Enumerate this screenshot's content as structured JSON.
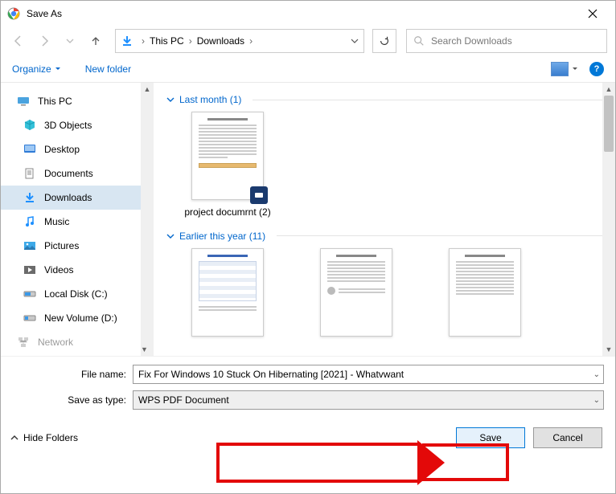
{
  "window": {
    "title": "Save As"
  },
  "nav": {
    "crumb1": "This PC",
    "crumb2": "Downloads",
    "search_placeholder": "Search Downloads"
  },
  "toolbar": {
    "organize": "Organize",
    "new_folder": "New folder"
  },
  "tree": {
    "this_pc": "This PC",
    "objects3d": "3D Objects",
    "desktop": "Desktop",
    "documents": "Documents",
    "downloads": "Downloads",
    "music": "Music",
    "pictures": "Pictures",
    "videos": "Videos",
    "local_c": "Local Disk (C:)",
    "new_vol_d": "New Volume (D:)",
    "network": "Network"
  },
  "groups": {
    "last_month": "Last month (1)",
    "earlier_year": "Earlier this year (11)"
  },
  "files": {
    "f1": "project documrnt (2)"
  },
  "form": {
    "file_name_label": "File name:",
    "file_name_value": "Fix For Windows 10 Stuck On Hibernating [2021] - Whatvwant",
    "save_type_label": "Save as type:",
    "save_type_value": "WPS PDF Document"
  },
  "footer": {
    "hide_folders": "Hide Folders",
    "save": "Save",
    "cancel": "Cancel"
  }
}
